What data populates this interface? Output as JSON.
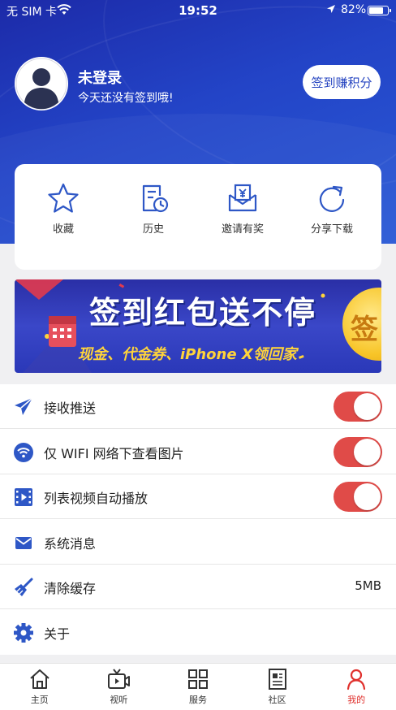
{
  "status_bar": {
    "carrier": "无 SIM 卡",
    "time": "19:52",
    "battery_percent": "82%",
    "battery_level": 0.82,
    "icons": [
      "wifi-icon",
      "location-arrow-icon",
      "battery-icon"
    ]
  },
  "profile": {
    "username": "未登录",
    "checkin_hint": "今天还没有签到哦!",
    "checkin_button": "签到赚积分"
  },
  "quick_actions": [
    {
      "label": "收藏",
      "icon": "star-icon"
    },
    {
      "label": "历史",
      "icon": "history-icon"
    },
    {
      "label": "邀请有奖",
      "icon": "invite-envelope-icon"
    },
    {
      "label": "分享下载",
      "icon": "share-icon"
    }
  ],
  "banner": {
    "title": "签到红包送不停",
    "subtitle": "现金、代金券、iPhone X领回家",
    "coin_char": "签"
  },
  "settings": [
    {
      "label": "接收推送",
      "icon": "paper-plane-icon",
      "toggle": true
    },
    {
      "label": "仅 WIFI 网络下查看图片",
      "icon": "wifi-circle-icon",
      "toggle": true
    },
    {
      "label": "列表视频自动播放",
      "icon": "video-film-icon",
      "toggle": true
    },
    {
      "label": "系统消息",
      "icon": "mail-icon"
    },
    {
      "label": "清除缓存",
      "icon": "broom-icon",
      "value": "5MB"
    },
    {
      "label": "关于",
      "icon": "gear-icon"
    }
  ],
  "tabs": [
    {
      "label": "主页",
      "icon": "home-icon"
    },
    {
      "label": "视听",
      "icon": "tv-video-icon"
    },
    {
      "label": "服务",
      "icon": "grid-icon"
    },
    {
      "label": "社区",
      "icon": "newspaper-icon"
    },
    {
      "label": "我的",
      "icon": "person-icon",
      "active": true
    }
  ],
  "colors": {
    "header_blue": "#2344c7",
    "accent_blue": "#2e57c6",
    "toggle_on": "#e04b48",
    "active_tab": "#e0312d"
  }
}
